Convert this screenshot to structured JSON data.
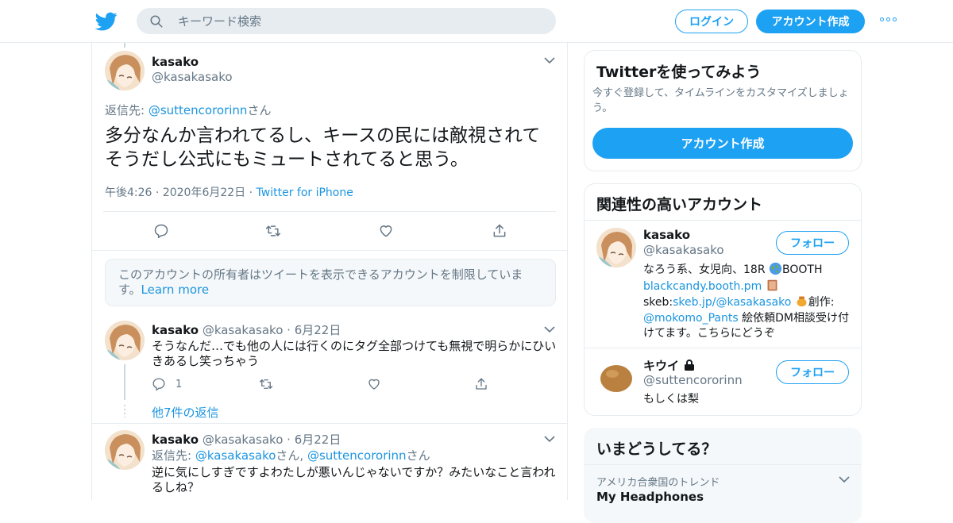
{
  "header": {
    "search_placeholder": "キーワード検索",
    "login_label": "ログイン",
    "signup_label": "アカウント作成"
  },
  "main_tweet": {
    "name": "kasako",
    "handle": "@kasakasako",
    "reply_prefix": "返信先: ",
    "reply_to": "@suttencororinn",
    "reply_suffix": "さん",
    "text_line1": "多分なんか言われてるし、キースの民には敵視されて",
    "text_line2": "そうだし公式にもミュートされてると思う。",
    "time": "午後4:26",
    "date": "2020年6月22日",
    "source": "Twitter for iPhone"
  },
  "notice": {
    "text": "このアカウントの所有者はツイートを表示できるアカウントを制限していま す。",
    "link": "Learn more"
  },
  "replies": [
    {
      "name": "kasako",
      "handle": "@kasakasako",
      "date": "6月22日",
      "text": "そうなんだ…でも他の人には行くのにタグ全部つけても無視で明らかにひいきあるし笑っちゃう",
      "reply_count": "1"
    },
    {
      "name": "kasako",
      "handle": "@kasakasako",
      "date": "6月22日",
      "reply_prefix": "返信先: ",
      "reply_to_1": "@kasakasako",
      "reply_mid": "さん, ",
      "reply_to_2": "@suttencororinn",
      "reply_suffix": "さん",
      "text": "逆に気にしすぎですよわたしが悪いんじゃないですか？みたいなこと言われるしね？"
    }
  ],
  "more_replies": "他7件の返信",
  "sidebar": {
    "signup_card": {
      "title": "Twitterを使ってみよう",
      "desc": "今すぐ登録して、タイムラインをカスタマイズしましょう。",
      "button": "アカウント作成"
    },
    "related": {
      "title": "関連性の高いアカウント",
      "accounts": [
        {
          "name": "kasako",
          "handle": "@kasakasako",
          "follow": "フォロー",
          "bio_1": "なろう系、女児向、18R ",
          "bio_2": "BOOTH",
          "bio_link_1": "blackcandy.booth.pm",
          "bio_3": "skeb:",
          "bio_link_2": "skeb.jp/@kasakasako",
          "bio_4": "創作:",
          "bio_link_3": "@mokomo_Pants",
          "bio_5": " 絵依頼DM相談受け付けてます。こちらにどうぞ"
        },
        {
          "name": "キウイ",
          "handle": "@suttencororinn",
          "follow": "フォロー",
          "bio": "もしくは梨"
        }
      ]
    },
    "trends": {
      "title": "いまどうしてる？",
      "items": [
        {
          "context": "アメリカ合衆国のトレンド",
          "name": "My Headphones"
        }
      ]
    }
  },
  "colors": {
    "accent": "#1da1f2",
    "link": "#1b95e0",
    "muted": "#657786",
    "border": "#e6ecf0"
  }
}
